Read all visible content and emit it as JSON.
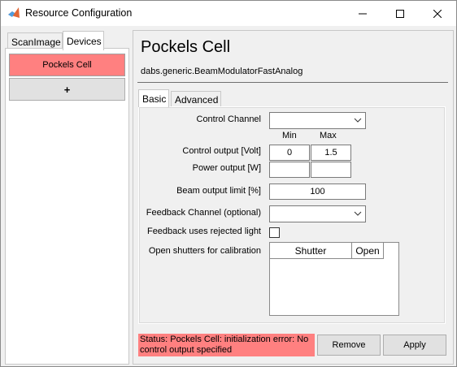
{
  "window": {
    "title": "Resource Configuration",
    "minimize_glyph": "—",
    "maximize_glyph": "☐",
    "close_glyph": "✕"
  },
  "left": {
    "tabs": [
      {
        "label": "ScanImage",
        "active": false
      },
      {
        "label": "Devices",
        "active": true
      }
    ],
    "device_items": [
      {
        "label": "Pockels Cell",
        "selected": true,
        "color": "#ff8080"
      }
    ],
    "add_label": "+"
  },
  "device": {
    "title": "Pockels Cell",
    "class_name": "dabs.generic.BeamModulatorFastAnalog"
  },
  "inner_tabs": [
    {
      "label": "Basic",
      "active": true
    },
    {
      "label": "Advanced",
      "active": false
    }
  ],
  "form": {
    "control_channel_label": "Control Channel",
    "control_channel_value": "",
    "min_header": "Min",
    "max_header": "Max",
    "control_output_label": "Control output [Volt]",
    "control_output_min": "0",
    "control_output_max": "1.5",
    "power_output_label": "Power output [W]",
    "power_output_min": "",
    "power_output_max": "",
    "beam_limit_label": "Beam output limit [%]",
    "beam_limit_value": "100",
    "feedback_channel_label": "Feedback Channel (optional)",
    "feedback_channel_value": "",
    "feedback_rejected_label": "Feedback uses rejected light",
    "feedback_rejected_checked": false,
    "shutters_label": "Open shutters for calibration",
    "shutter_table": {
      "columns": [
        "Shutter",
        "Open"
      ],
      "rows": []
    }
  },
  "status": {
    "text": "Status: Pockels Cell: initialization error: No control output specified",
    "color": "#ff8080"
  },
  "buttons": {
    "remove": "Remove",
    "apply": "Apply"
  }
}
